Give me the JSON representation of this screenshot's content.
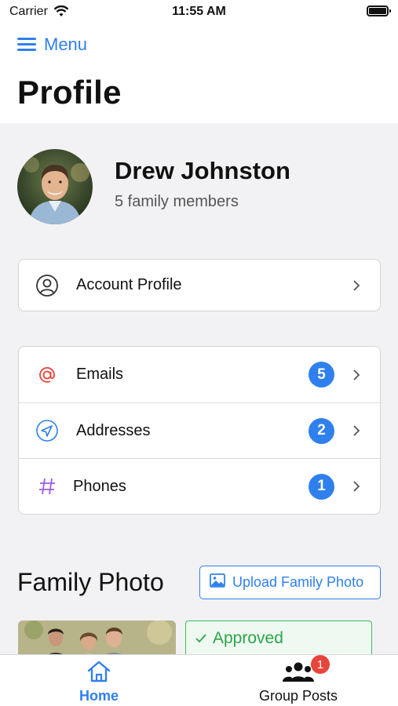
{
  "status_bar": {
    "carrier": "Carrier",
    "time": "11:55 AM"
  },
  "nav": {
    "menu_label": "Menu"
  },
  "page": {
    "title": "Profile"
  },
  "profile": {
    "name": "Drew Johnston",
    "members": "5 family members"
  },
  "account": {
    "label": "Account Profile",
    "icon": "user-circle-icon"
  },
  "contact_items": [
    {
      "label": "Emails",
      "count": "5",
      "icon": "at-icon",
      "color": "#e8453c"
    },
    {
      "label": "Addresses",
      "count": "2",
      "icon": "navigation-arrow-icon",
      "color": "#2f80ed"
    },
    {
      "label": "Phones",
      "count": "1",
      "icon": "hash-icon",
      "color": "#9b5de5"
    }
  ],
  "family_photo": {
    "title": "Family Photo",
    "upload_label": "Upload Family Photo",
    "status": "Approved"
  },
  "tabbar": {
    "home_label": "Home",
    "group_label": "Group Posts",
    "group_notifications": "1"
  },
  "colors": {
    "accent": "#2f80ed",
    "success": "#3dbb5c",
    "alert": "#e8453c"
  }
}
